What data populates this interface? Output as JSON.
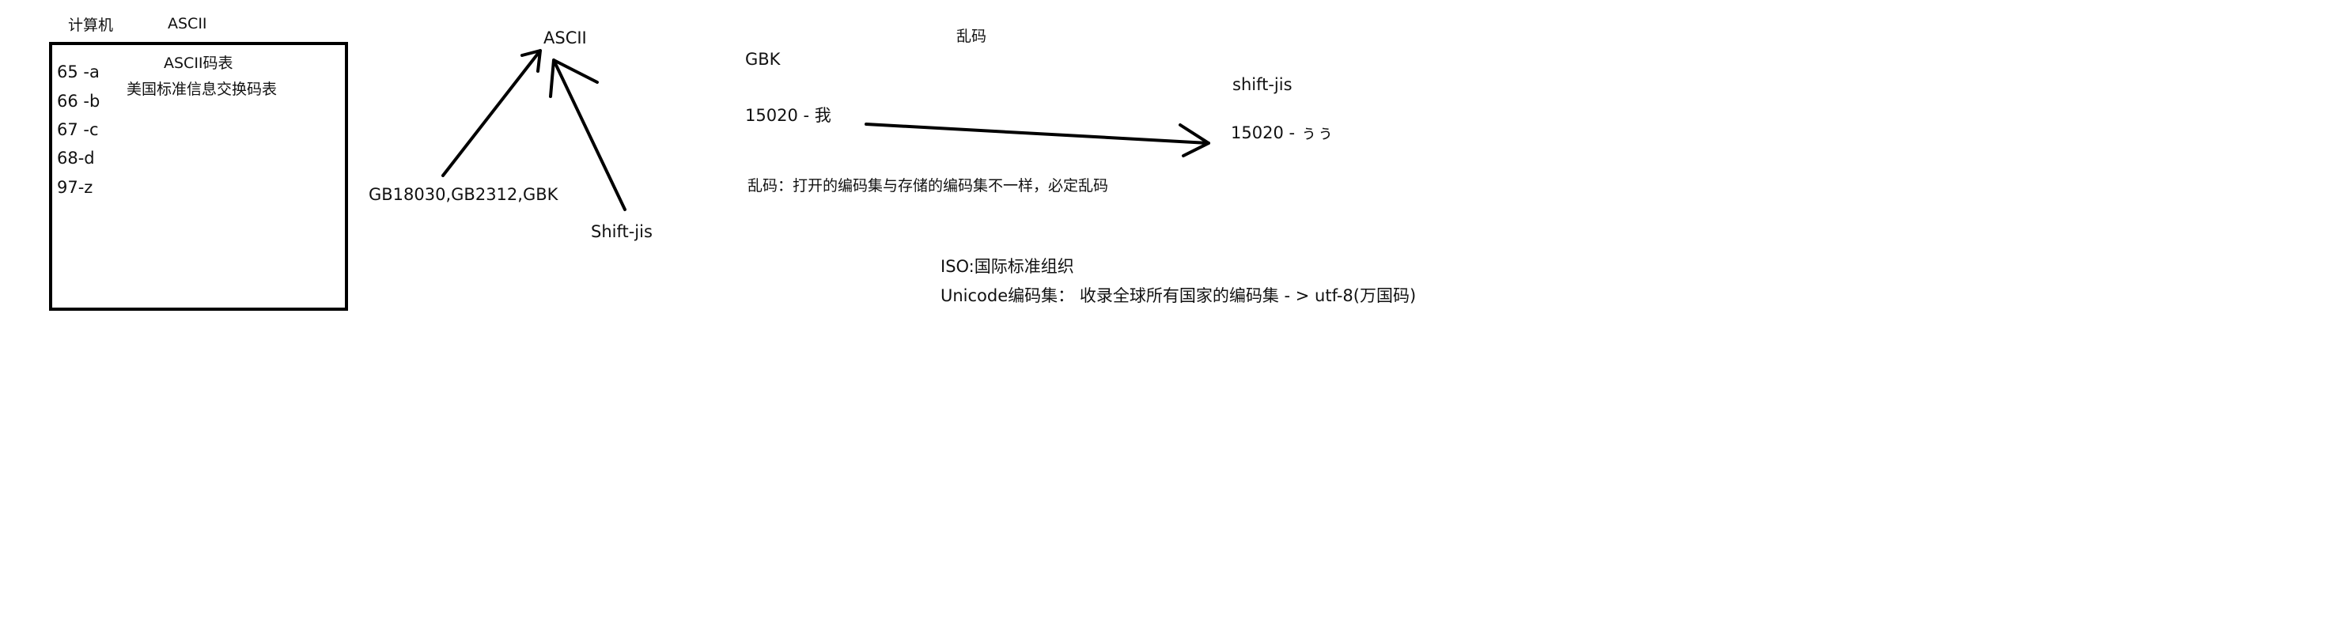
{
  "canvas": {
    "background": "#ffffff",
    "ink": "#000000"
  },
  "header": {
    "computer_label": "计算机",
    "ascii_label": "ASCII"
  },
  "ascii_box": {
    "title": "ASCII码表",
    "subtitle": "美国标准信息交换码表",
    "entries": [
      "65 -a",
      "66 -b",
      "67 -c",
      "68-d",
      "97-z"
    ]
  },
  "encoding_tree": {
    "root": "ASCII",
    "chinese_sets": "GB18030,GB2312,GBK",
    "japanese_set": "Shift-jis"
  },
  "garbled_example": {
    "title": "乱码",
    "source_encoding": "GBK",
    "source_value": "15020  - 我",
    "target_encoding": "shift-jis",
    "target_value": "15020 - ぅぅ",
    "rule": "乱码：打开的编码集与存储的编码集不一样，必定乱码"
  },
  "standards": {
    "iso": "ISO:国际标准组织",
    "unicode": "Unicode编码集：  收录全球所有国家的编码集 - > utf-8(万国码)"
  }
}
